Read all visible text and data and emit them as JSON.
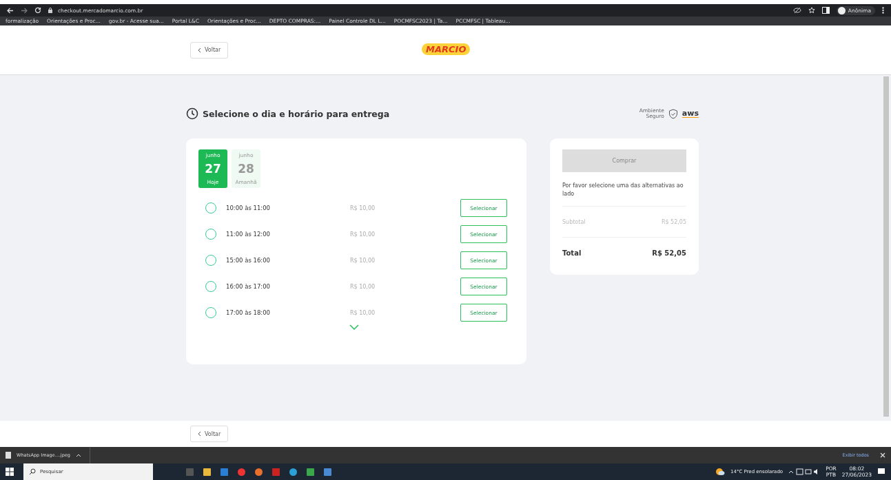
{
  "browser": {
    "url": "checkout.mercadomarcio.com.br",
    "profile": "Anônima"
  },
  "bookmarks": [
    "formalização",
    "Orientações e Proc...",
    "gov.br - Acesse sua...",
    "Portal L&C",
    "Orientações e Proc...",
    "DEPTO COMPRAS:...",
    "Painel Controle DL L...",
    "POCMFSC2023 | Ta...",
    "PCCMFSC | Tableau..."
  ],
  "header": {
    "back": "Voltar",
    "logo": "MARCIO"
  },
  "heading": "Selecione o dia e horário para entrega",
  "secure": {
    "line1": "Ambiente",
    "line2": "Seguro",
    "brand": "aws"
  },
  "days": [
    {
      "month": "junho",
      "day": "27",
      "label": "Hoje",
      "selected": true
    },
    {
      "month": "junho",
      "day": "28",
      "label": "Amanhã",
      "selected": false
    }
  ],
  "slots": [
    {
      "time": "10:00 às 11:00",
      "price": "R$ 10,00",
      "button": "Selecionar",
      "selected": false
    },
    {
      "time": "11:00 às 12:00",
      "price": "R$ 10,00",
      "button": "Selecionar",
      "selected": false
    },
    {
      "time": "15:00 às 16:00",
      "price": "R$ 10,00",
      "button": "Selecionar",
      "selected": false
    },
    {
      "time": "16:00 às 17:00",
      "price": "R$ 10,00",
      "button": "Selecionar",
      "selected": false
    },
    {
      "time": "17:00 às 18:00",
      "price": "R$ 10,00",
      "button": "Selecionar",
      "selected": false
    }
  ],
  "summary": {
    "buy": "Comprar",
    "buy_disabled": true,
    "hint": "Por favor selecione uma das alternativas ao lado",
    "subtotal_label": "Subtotal",
    "subtotal": "R$ 52,05",
    "total_label": "Total",
    "total": "R$ 52,05"
  },
  "footer": {
    "back": "Voltar"
  },
  "downloads": {
    "file": "WhatsApp Image....jpeg",
    "show_all": "Exibir todos"
  },
  "taskbar": {
    "search": "Pesquisar",
    "weather": "14°C  Pred ensolarado",
    "lang1": "POR",
    "lang2": "PTB",
    "time": "08:02",
    "date": "27/06/2023"
  }
}
